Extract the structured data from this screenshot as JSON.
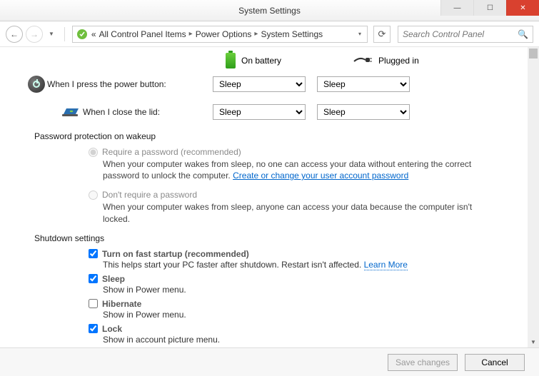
{
  "window": {
    "title": "System Settings"
  },
  "breadcrumb": {
    "items": [
      "All Control Panel Items",
      "Power Options",
      "System Settings"
    ]
  },
  "search": {
    "placeholder": "Search Control Panel"
  },
  "columns": {
    "battery": "On battery",
    "plugged": "Plugged in"
  },
  "rows": {
    "power_button": {
      "label": "When I press the power button:",
      "battery_value": "Sleep",
      "plugged_value": "Sleep"
    },
    "close_lid": {
      "label": "When I close the lid:",
      "battery_value": "Sleep",
      "plugged_value": "Sleep"
    }
  },
  "password_section": {
    "heading": "Password protection on wakeup",
    "require": {
      "label": "Require a password (recommended)",
      "desc_prefix": "When your computer wakes from sleep, no one can access your data without entering the correct password to unlock the computer. ",
      "link": "Create or change your user account password"
    },
    "dont_require": {
      "label": "Don't require a password",
      "desc": "When your computer wakes from sleep, anyone can access your data because the computer isn't locked."
    }
  },
  "shutdown_section": {
    "heading": "Shutdown settings",
    "fast_startup": {
      "label": "Turn on fast startup (recommended)",
      "desc": "This helps start your PC faster after shutdown. Restart isn't affected. ",
      "link": "Learn More"
    },
    "sleep": {
      "label": "Sleep",
      "desc": "Show in Power menu."
    },
    "hibernate": {
      "label": "Hibernate",
      "desc": "Show in Power menu."
    },
    "lock": {
      "label": "Lock",
      "desc": "Show in account picture menu."
    }
  },
  "buttons": {
    "save": "Save changes",
    "cancel": "Cancel"
  }
}
